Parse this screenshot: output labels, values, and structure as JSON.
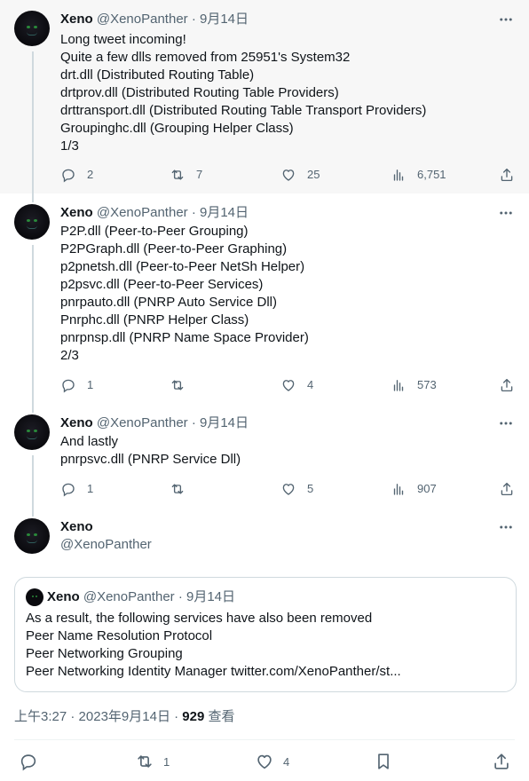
{
  "tweets": [
    {
      "name": "Xeno",
      "handle": "@XenoPanther",
      "dot": "·",
      "date": "9月14日",
      "lines": [
        "Long tweet incoming!",
        "Quite a few dlls removed from 25951's System32",
        "drt.dll (Distributed Routing Table)",
        "drtprov.dll (Distributed Routing Table Providers)",
        "drttransport.dll (Distributed Routing Table Transport Providers)",
        "Groupinghc.dll (Grouping Helper Class)",
        "1/3"
      ],
      "replies": "2",
      "retweets": "7",
      "likes": "25",
      "views": "6,751"
    },
    {
      "name": "Xeno",
      "handle": "@XenoPanther",
      "dot": "·",
      "date": "9月14日",
      "lines": [
        "P2P.dll (Peer-to-Peer Grouping)",
        "P2PGraph.dll (Peer-to-Peer Graphing)",
        "p2pnetsh.dll (Peer-to-Peer NetSh Helper)",
        "p2psvc.dll (Peer-to-Peer Services)",
        "pnrpauto.dll (PNRP Auto Service Dll)",
        "Pnrphc.dll (PNRP Helper Class)",
        "pnrpnsp.dll (PNRP Name Space Provider)",
        "2/3"
      ],
      "replies": "1",
      "retweets": "",
      "likes": "4",
      "views": "573"
    },
    {
      "name": "Xeno",
      "handle": "@XenoPanther",
      "dot": "·",
      "date": "9月14日",
      "lines": [
        "And lastly",
        "pnrpsvc.dll (PNRP Service Dll)"
      ],
      "replies": "1",
      "retweets": "",
      "likes": "5",
      "views": "907"
    }
  ],
  "main": {
    "name": "Xeno",
    "handle": "@XenoPanther",
    "quote": {
      "name": "Xeno",
      "handle": "@XenoPanther",
      "dot": "·",
      "date": "9月14日",
      "lines": [
        "As a result, the following services have also been removed",
        "Peer Name Resolution Protocol",
        "Peer Networking Grouping",
        "Peer Networking Identity Manager twitter.com/XenoPanther/st..."
      ]
    },
    "meta": {
      "time": "上午3:27",
      "sep1": "·",
      "date": "2023年9月14日",
      "sep2": "·",
      "views_count": "929",
      "views_label": "查看"
    },
    "retweets": "1",
    "likes": "4"
  },
  "icons": {
    "reply": "reply-icon",
    "retweet": "retweet-icon",
    "like": "heart-icon",
    "views": "analytics-icon",
    "share": "share-icon",
    "bookmark": "bookmark-icon",
    "more": "more-icon"
  }
}
